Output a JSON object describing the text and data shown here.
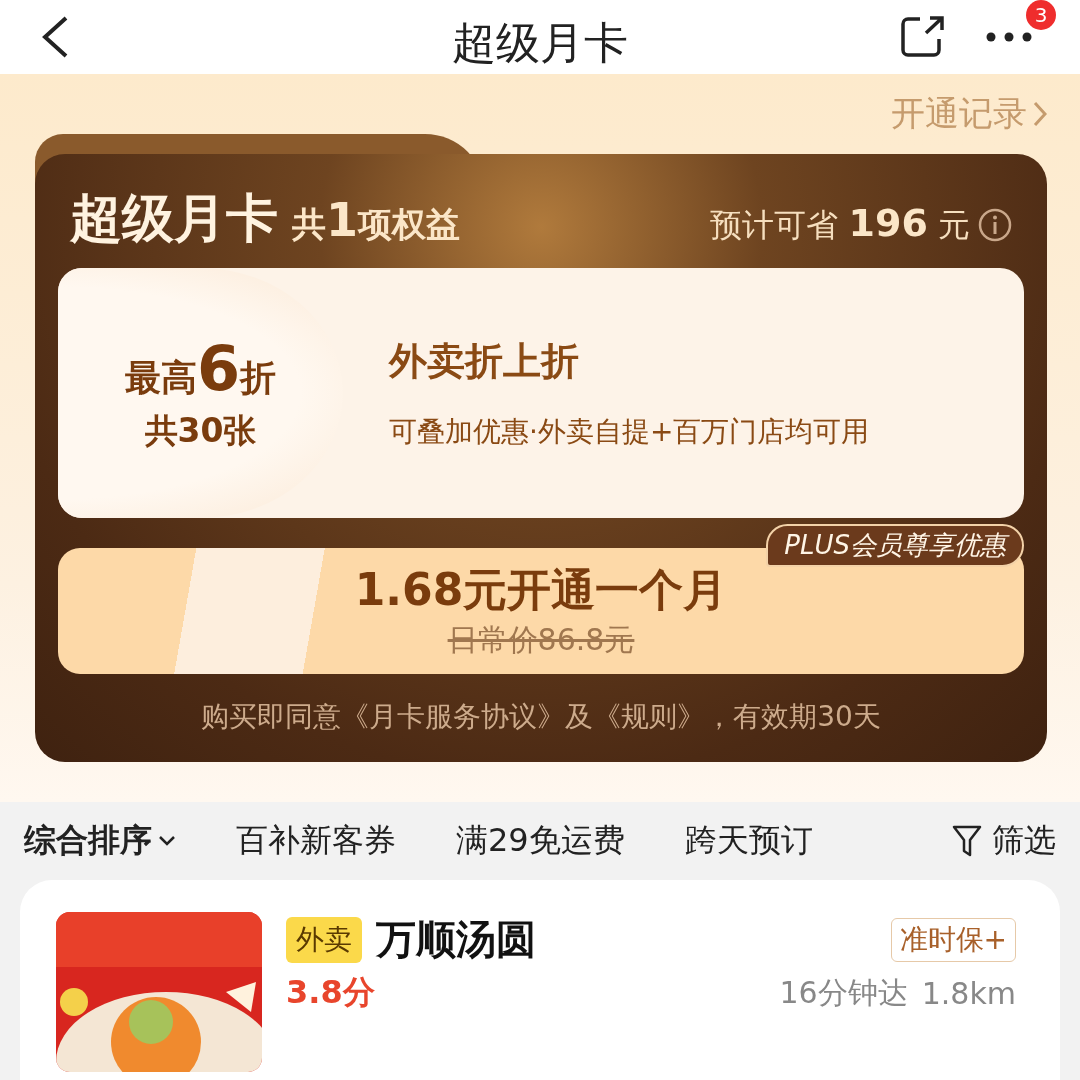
{
  "nav": {
    "title": "超级月卡",
    "badge": "3"
  },
  "records_link": "开通记录",
  "card": {
    "title": "超级月卡",
    "benefit_prefix": "共",
    "benefit_count": "1",
    "benefit_suffix": "项权益",
    "savings_prefix": "预计可省",
    "savings_amount": "196",
    "savings_suffix": "元"
  },
  "coupon": {
    "prefix": "最高",
    "value": "6",
    "unit": "折",
    "count": "共30张",
    "title": "外卖折上折",
    "desc": "可叠加优惠·外卖自提+百万门店均可用"
  },
  "offer": {
    "tag": "PLUS会员尊享优惠",
    "price": "1.68元开通一个月",
    "original": "日常价86.8元"
  },
  "agreement": "购买即同意《月卡服务协议》及《规则》，有效期30天",
  "filters": [
    {
      "label": "综合排序",
      "kind": "dropdown",
      "selected": true
    },
    {
      "label": "百补新客券",
      "kind": "chip",
      "selected": false
    },
    {
      "label": "满29免运费",
      "kind": "chip",
      "selected": false
    },
    {
      "label": "跨天预订",
      "kind": "chip",
      "selected": false
    }
  ],
  "filter_button": "筛选",
  "shop": {
    "tag": "外卖",
    "name": "万顺汤圆",
    "rating": "3.8分",
    "badge": "准时保+",
    "delivery": "16分钟达",
    "distance": "1.8km",
    "kind": "picture"
  }
}
